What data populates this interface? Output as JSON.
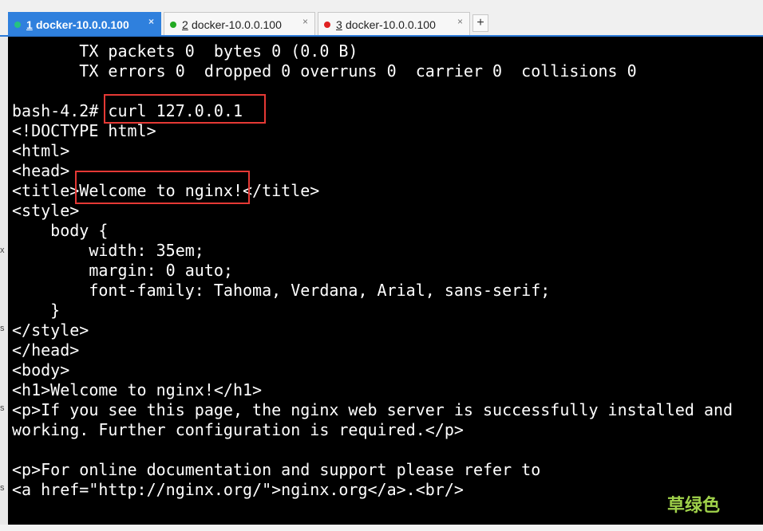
{
  "tabs": [
    {
      "num": "1",
      "label": " docker-10.0.0.100",
      "dot_color": "#26c281",
      "active": true
    },
    {
      "num": "2",
      "label": " docker-10.0.0.100",
      "dot_color": "#22aa22",
      "active": false
    },
    {
      "num": "3",
      "label": " docker-10.0.0.100",
      "dot_color": "#e02020",
      "active": false
    }
  ],
  "tab_close_glyph": "×",
  "add_tab_glyph": "+",
  "gutter_marks": [
    "x",
    "s",
    "s",
    "s"
  ],
  "terminal": {
    "lines": [
      "       TX packets 0  bytes 0 (0.0 B)",
      "       TX errors 0  dropped 0 overruns 0  carrier 0  collisions 0",
      "",
      "bash-4.2# curl 127.0.0.1",
      "<!DOCTYPE html>",
      "<html>",
      "<head>",
      "<title>Welcome to nginx!</title>",
      "<style>",
      "    body {",
      "        width: 35em;",
      "        margin: 0 auto;",
      "        font-family: Tahoma, Verdana, Arial, sans-serif;",
      "    }",
      "</style>",
      "</head>",
      "<body>",
      "<h1>Welcome to nginx!</h1>",
      "<p>If you see this page, the nginx web server is successfully installed and",
      "working. Further configuration is required.</p>",
      "",
      "<p>For online documentation and support please refer to",
      "<a href=\"http://nginx.org/\">nginx.org</a>.<br/>"
    ]
  },
  "watermark": "草绿色",
  "colors": {
    "highlight": "#e53935",
    "terminal_bg": "#000000",
    "tab_active": "#2f80dd"
  }
}
